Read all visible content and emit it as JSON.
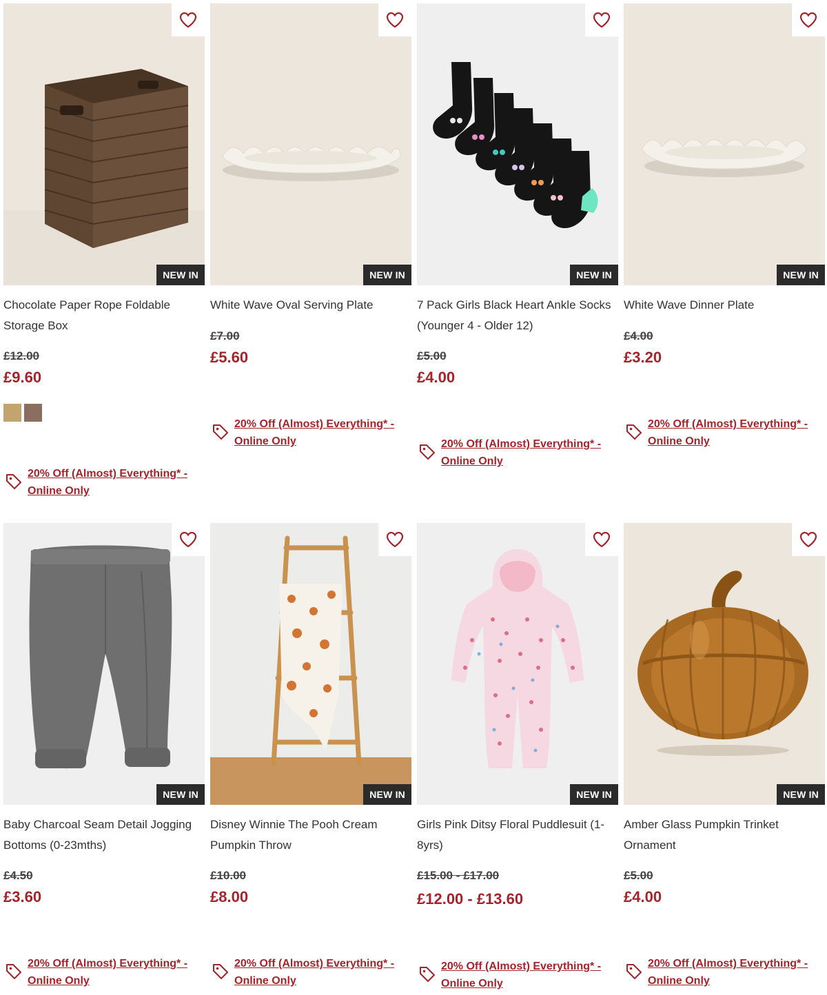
{
  "colors": {
    "price_sale": "#a4242b",
    "badge_bg": "#2b2b2b",
    "promo": "#a4242b"
  },
  "products": [
    {
      "name": "Chocolate Paper Rope Foldable Storage Box",
      "badge": "NEW IN",
      "was_price": "£12.00",
      "now_price": "£9.60",
      "swatches": [
        "#c4a46e",
        "#8b6f5e"
      ],
      "promo": "20% Off (Almost) Everything* - Online Only",
      "image": "storage-basket"
    },
    {
      "name": "White Wave Oval Serving Plate",
      "badge": "NEW IN",
      "was_price": "£7.00",
      "now_price": "£5.60",
      "promo": "20% Off (Almost) Everything* - Online Only",
      "image": "wave-plate"
    },
    {
      "name": "7 Pack Girls Black Heart Ankle Socks (Younger 4 - Older 12)",
      "badge": "NEW IN",
      "was_price": "£5.00",
      "now_price": "£4.00",
      "promo": "20% Off (Almost) Everything* - Online Only",
      "image": "socks"
    },
    {
      "name": "White Wave Dinner Plate",
      "badge": "NEW IN",
      "was_price": "£4.00",
      "now_price": "£3.20",
      "promo": "20% Off (Almost) Everything* - Online Only",
      "image": "wave-plate"
    },
    {
      "name": "Baby Charcoal Seam Detail Jogging Bottoms (0-23mths)",
      "badge": "NEW IN",
      "was_price": "£4.50",
      "now_price": "£3.60",
      "promo": "20% Off (Almost) Everything* - Online Only",
      "image": "joggers"
    },
    {
      "name": "Disney Winnie The Pooh Cream Pumpkin Throw",
      "badge": "NEW IN",
      "was_price": "£10.00",
      "now_price": "£8.00",
      "promo": "20% Off (Almost) Everything* - Online Only",
      "image": "throw-ladder"
    },
    {
      "name": "Girls Pink Ditsy Floral Puddlesuit (1-8yrs)",
      "badge": "NEW IN",
      "was_price": "£15.00 - £17.00",
      "now_price": "£12.00 - £13.60",
      "promo": "20% Off (Almost) Everything* - Online Only",
      "image": "puddlesuit"
    },
    {
      "name": "Amber Glass Pumpkin Trinket Ornament",
      "badge": "NEW IN",
      "was_price": "£5.00",
      "now_price": "£4.00",
      "promo": "20% Off (Almost) Everything* - Online Only",
      "image": "amber-pumpkin"
    }
  ]
}
